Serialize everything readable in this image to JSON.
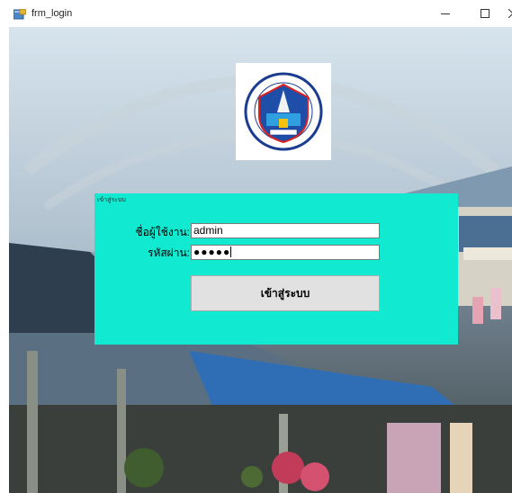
{
  "window": {
    "title": "frm_login"
  },
  "login_panel": {
    "caption": "เข้าสู่ระบบ",
    "username_label": "ชื่อผู้ใช้งาน:",
    "username_value": "admin",
    "password_label": "รหัสผ่าน:",
    "password_value": "●●●●●",
    "login_button_label": "เข้าสู่ระบบ"
  },
  "colors": {
    "panel": "#12e9d1",
    "button": "#e1e1e1",
    "titlebar": "#ffffff"
  },
  "icons": {
    "app": "form-app-icon",
    "minimize": "minimize-icon",
    "maximize": "maximize-icon",
    "close": "close-icon",
    "logo": "school-logo"
  }
}
